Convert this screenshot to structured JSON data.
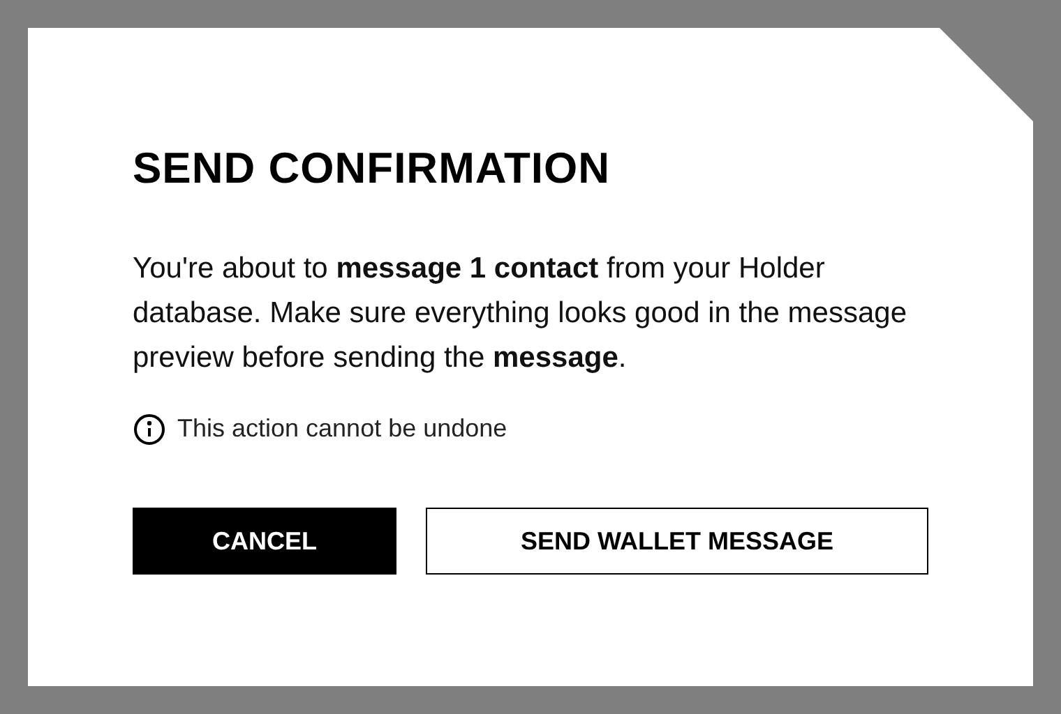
{
  "dialog": {
    "title": "SEND CONFIRMATION",
    "message": "You're about to **message 1 contact** from your Holder database. Make sure everything looks good in the message preview before sending the **message**.",
    "notice": "This action cannot be undone",
    "buttons": [
      {
        "label": "CANCEL",
        "kind": "primary"
      },
      {
        "label": "SEND WALLET MESSAGE",
        "kind": "outline"
      }
    ]
  }
}
